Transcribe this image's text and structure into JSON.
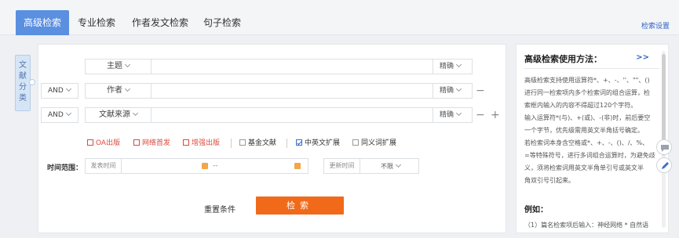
{
  "tabs": [
    {
      "label": "高级检索",
      "active": true
    },
    {
      "label": "专业检索",
      "active": false
    },
    {
      "label": "作者发文检索",
      "active": false
    },
    {
      "label": "句子检索",
      "active": false
    }
  ],
  "settings_link": "检索设置",
  "side_tab": {
    "label": "文献分类"
  },
  "rows": [
    {
      "op": "",
      "field": "主题",
      "mode": "精确"
    },
    {
      "op": "AND",
      "field": "作者",
      "mode": "精确"
    },
    {
      "op": "AND",
      "field": "文献来源",
      "mode": "精确"
    }
  ],
  "row_controls": {
    "minus": "−",
    "plus": "+"
  },
  "checkboxes": [
    {
      "label": "OA出版",
      "checked": false,
      "red": true
    },
    {
      "label": "网络首发",
      "checked": false,
      "red": true
    },
    {
      "label": "增强出版",
      "checked": false,
      "red": true
    },
    {
      "label": "基金文献",
      "checked": false,
      "red": false
    },
    {
      "label": "中英文扩展",
      "checked": true,
      "red": false
    },
    {
      "label": "同义词扩展",
      "checked": false,
      "red": false
    }
  ],
  "time_range": {
    "label": "时间范围：",
    "publish_time_label": "发表时间",
    "separator": "--",
    "update_time_label": "更新时间",
    "update_value": "不限"
  },
  "actions": {
    "reset": "重置条件",
    "search": "检索"
  },
  "help": {
    "title": "高级检索使用方法：",
    "more": ">>",
    "body": [
      "高级检索支持使用运算符*、+、-、''、\"\"、()",
      "进行同一检索项内多个检索词的组合运算，检",
      "索框内输入的内容不得超过120个字符。",
      "输入运算符*(与)、+(或)、-(非)时，前后要空",
      "一个字节，优先级需用英文半角括号确定。",
      "若检索词本身含空格或*、+、-、()、/、%、",
      "=等特殊符号，进行多词组合运算时，为避免歧",
      "义，须将检索词用英文半角单引号或英文半",
      "角双引号引起来。"
    ],
    "example_title": "例如：",
    "example_1": "（1）篇名检索项后输入：神经网络 * 自然语"
  },
  "colors": {
    "accent": "#5b8fe0",
    "search_button": "#f06a1a",
    "link": "#2f63c5",
    "highlight_red": "#d94a3d"
  }
}
